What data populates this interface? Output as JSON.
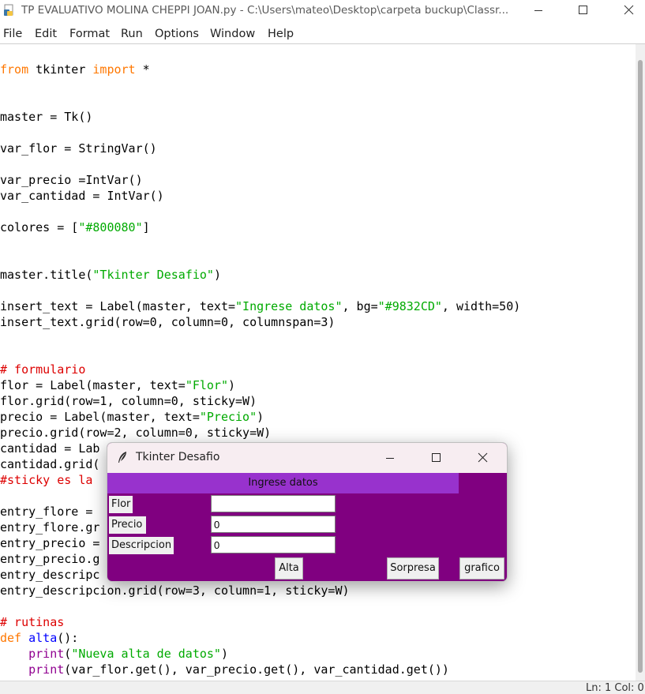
{
  "window": {
    "title": "TP EVALUATIVO MOLINA CHEPPI JOAN.py - C:\\Users\\mateo\\Desktop\\carpeta buckup\\Classr..."
  },
  "menu": [
    "File",
    "Edit",
    "Format",
    "Run",
    "Options",
    "Window",
    "Help"
  ],
  "code": [
    {
      "line": 2,
      "tokens": [
        {
          "t": "from",
          "c": "kw"
        },
        {
          "t": " tkinter "
        },
        {
          "t": "import",
          "c": "kw"
        },
        {
          "t": " *"
        }
      ]
    },
    {
      "line": 5,
      "tokens": [
        {
          "t": "master = Tk()"
        }
      ]
    },
    {
      "line": 7,
      "tokens": [
        {
          "t": "var_flor = StringVar()"
        }
      ]
    },
    {
      "line": 9,
      "tokens": [
        {
          "t": "var_precio =IntVar()"
        }
      ]
    },
    {
      "line": 10,
      "tokens": [
        {
          "t": "var_cantidad = IntVar()"
        }
      ]
    },
    {
      "line": 12,
      "tokens": [
        {
          "t": "colores = ["
        },
        {
          "t": "\"#800080\"",
          "c": "str"
        },
        {
          "t": "]"
        }
      ]
    },
    {
      "line": 15,
      "tokens": [
        {
          "t": "master.title("
        },
        {
          "t": "\"Tkinter Desafio\"",
          "c": "str"
        },
        {
          "t": ")"
        }
      ]
    },
    {
      "line": 17,
      "tokens": [
        {
          "t": "insert_text = Label(master, text="
        },
        {
          "t": "\"Ingrese datos\"",
          "c": "str"
        },
        {
          "t": ", bg="
        },
        {
          "t": "\"#9832CD\"",
          "c": "str"
        },
        {
          "t": ", width=50)"
        }
      ]
    },
    {
      "line": 18,
      "tokens": [
        {
          "t": "insert_text.grid(row=0, column=0, columnspan=3)"
        }
      ]
    },
    {
      "line": 21,
      "tokens": [
        {
          "t": "# formulario",
          "c": "cm"
        }
      ]
    },
    {
      "line": 22,
      "tokens": [
        {
          "t": "flor = Label(master, text="
        },
        {
          "t": "\"Flor\"",
          "c": "str"
        },
        {
          "t": ")"
        }
      ]
    },
    {
      "line": 23,
      "tokens": [
        {
          "t": "flor.grid(row=1, column=0, sticky=W)"
        }
      ]
    },
    {
      "line": 24,
      "tokens": [
        {
          "t": "precio = Label(master, text="
        },
        {
          "t": "\"Precio\"",
          "c": "str"
        },
        {
          "t": ")"
        }
      ]
    },
    {
      "line": 25,
      "tokens": [
        {
          "t": "precio.grid(row=2, column=0, sticky=W)"
        }
      ]
    },
    {
      "line": 26,
      "tokens": [
        {
          "t": "cantidad = Lab"
        }
      ]
    },
    {
      "line": 27,
      "tokens": [
        {
          "t": "cantidad.grid("
        }
      ]
    },
    {
      "line": 28,
      "tokens": [
        {
          "t": "#sticky es la",
          "c": "cm"
        }
      ]
    },
    {
      "line": 30,
      "tokens": [
        {
          "t": "entry_flore ="
        }
      ]
    },
    {
      "line": 31,
      "tokens": [
        {
          "t": "entry_flore.gr"
        }
      ]
    },
    {
      "line": 32,
      "tokens": [
        {
          "t": "entry_precio ="
        }
      ]
    },
    {
      "line": 33,
      "tokens": [
        {
          "t": "entry_precio.g"
        }
      ]
    },
    {
      "line": 34,
      "tokens": [
        {
          "t": "entry_descripc"
        }
      ]
    },
    {
      "line": 35,
      "tokens": [
        {
          "t": "entry_descripcion.grid(row=3, column=1, sticky=W)"
        }
      ]
    },
    {
      "line": 37,
      "tokens": [
        {
          "t": "# rutinas",
          "c": "cm"
        }
      ]
    },
    {
      "line": 38,
      "tokens": [
        {
          "t": "def",
          "c": "kw"
        },
        {
          "t": " "
        },
        {
          "t": "alta",
          "c": "df"
        },
        {
          "t": "():"
        }
      ]
    },
    {
      "line": 39,
      "tokens": [
        {
          "t": "    "
        },
        {
          "t": "print",
          "c": "bi"
        },
        {
          "t": "("
        },
        {
          "t": "\"Nueva alta de datos\"",
          "c": "str"
        },
        {
          "t": ")"
        }
      ]
    },
    {
      "line": 40,
      "tokens": [
        {
          "t": "    "
        },
        {
          "t": "print",
          "c": "bi"
        },
        {
          "t": "(var_flor.get(), var_precio.get(), var_cantidad.get())"
        }
      ]
    }
  ],
  "status": {
    "text": "Ln: 1   Col: 0"
  },
  "popup": {
    "title": "Tkinter Desafio",
    "bg_color": "#800080",
    "header_color": "#9832CD",
    "header_label": "Ingrese datos",
    "labels": {
      "flor": "Flor",
      "precio": "Precio",
      "descripcion": "Descripcion"
    },
    "entries": {
      "flor": "",
      "precio": "0",
      "descripcion": "0"
    },
    "buttons": {
      "alta": "Alta",
      "sorpresa": "Sorpresa",
      "grafico": "grafico"
    }
  }
}
